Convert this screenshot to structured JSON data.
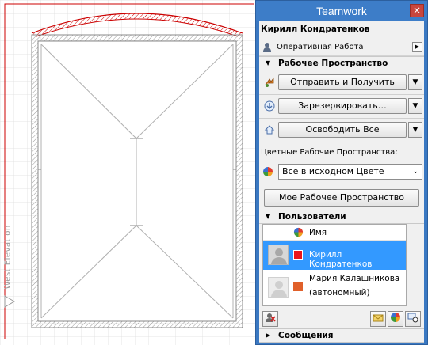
{
  "canvas": {
    "elevation_label": "West Elevation"
  },
  "palette": {
    "title": "Teamwork",
    "close_glyph": "×",
    "user_name": "Кирилл Кондратенков",
    "project": {
      "icon": "user-icon",
      "label": "Оперативная Работа",
      "menu_glyph": "▶"
    },
    "workspace": {
      "header": "Рабочее Пространство",
      "send_receive": "Отправить и Получить",
      "reserve": "Зарезервировать…",
      "release_all": "Освободить Все"
    },
    "color_workspaces": {
      "label": "Цветные Рабочие Пространства:",
      "selected": "Все в исходном Цвете",
      "my_workspace_button": "Мое Рабочее Пространство"
    },
    "users": {
      "header": "Пользователи",
      "column_name": "Имя",
      "rows": [
        {
          "name": "Кирилл Кондратенков",
          "color": "#e8141b",
          "selected": true
        },
        {
          "name": "Мария Калашникова",
          "status": "(автономный)",
          "color": "#e0602a",
          "selected": false
        }
      ]
    },
    "messages": {
      "header": "Сообщения"
    },
    "colors": {
      "title_bar": "#3d7dc8",
      "selection": "#3399ff",
      "close": "#c9463d",
      "drawing_red": "#cc0000"
    }
  }
}
